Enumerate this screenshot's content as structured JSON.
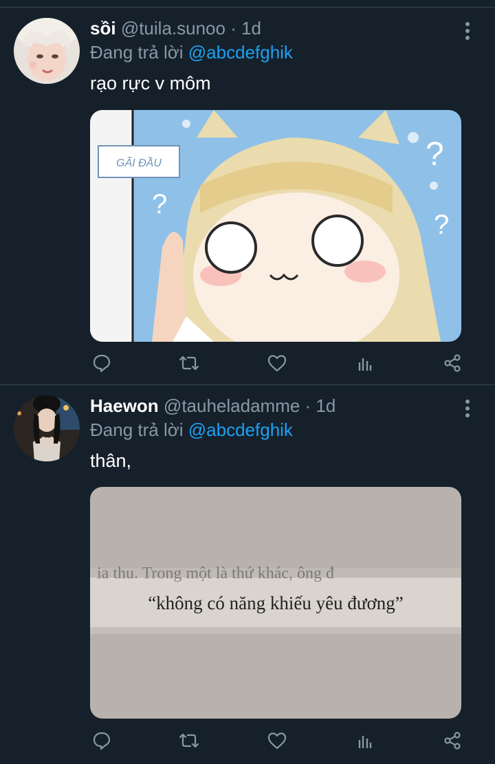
{
  "colors": {
    "background": "#15202b",
    "divider": "#38444d",
    "muted_text": "#8899a6",
    "mention": "#1da1f2",
    "icon": "#8899a6"
  },
  "tweets": [
    {
      "display_name": "sồi",
      "handle_and_time": "@tuila.sunoo · 1d",
      "reply_prefix": "Đang trả lời ",
      "reply_to": "@abcdefghik",
      "text": "rạo rực v môm",
      "image": {
        "caption_label": "GÃI ĐẦU",
        "description_icon": "anime-meme-image"
      }
    },
    {
      "display_name": "Haewon",
      "handle_and_time": "@tauheladamme · 1d",
      "reply_prefix": "Đang trả lời ",
      "reply_to": "@abcdefghik",
      "text": "thân,",
      "image": {
        "book_line": "“không có năng khiếu yêu đương”",
        "description_icon": "book-page-photo"
      }
    }
  ],
  "action_icons": [
    "reply-icon",
    "retweet-icon",
    "like-icon",
    "analytics-icon",
    "share-icon"
  ]
}
